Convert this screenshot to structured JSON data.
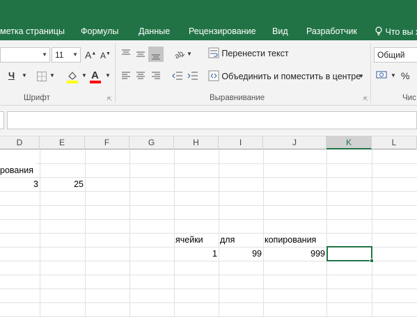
{
  "ribbon_tabs": [
    {
      "label": "метка страницы"
    },
    {
      "label": "Формулы"
    },
    {
      "label": "Данные"
    },
    {
      "label": "Рецензирование"
    },
    {
      "label": "Вид"
    },
    {
      "label": "Разработчик"
    }
  ],
  "tell_me": {
    "label": "Что вы х",
    "icon": "lightbulb-icon"
  },
  "font_group": {
    "font_size": "11",
    "label": "Шрифт",
    "underline_glyph": "Ч",
    "font_color_glyph": "A",
    "icons": [
      "increase-font-icon",
      "decrease-font-icon",
      "underline-icon",
      "borders-icon",
      "fill-color-icon",
      "font-color-icon"
    ],
    "colors": {
      "fill": "#ffff00",
      "font": "#ff0000"
    }
  },
  "alignment_group": {
    "wrap_text": "Перенести текст",
    "merge_center": "Объединить и поместить в центре",
    "label": "Выравнивание"
  },
  "number_group": {
    "format": "Общий",
    "label": "Чис",
    "percent_glyph": "%"
  },
  "columns": [
    "D",
    "E",
    "F",
    "G",
    "H",
    "I",
    "J",
    "K",
    "L"
  ],
  "selected_column": "K",
  "cells": {
    "d_row2": "рования",
    "d_row3": "3",
    "e_row3": "25",
    "h_row8": "ячейки",
    "i_row8": "для",
    "j_row8": "копирования",
    "h_row9": "1",
    "i_row9": "99",
    "j_row9": "999"
  },
  "colors": {
    "accent": "#217346",
    "header_bg": "#f0f0f0",
    "grid": "#e1e1e1"
  }
}
